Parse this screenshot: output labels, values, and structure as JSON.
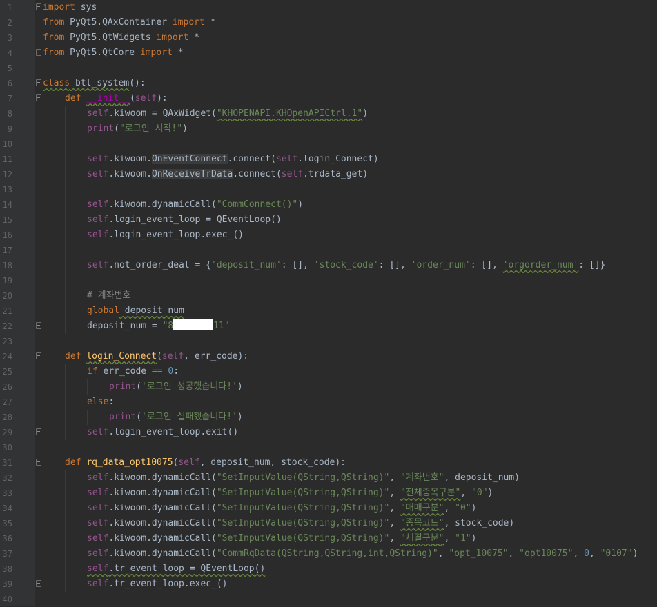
{
  "editor": {
    "colors": {
      "background": "#2b2b2b",
      "keyword": "#cc7832",
      "string": "#6a8759",
      "self": "#94558d",
      "number": "#6897bb",
      "comment": "#808080",
      "function": "#ffc66d"
    },
    "line_numbers": [
      "1",
      "2",
      "3",
      "4",
      "5",
      "6",
      "7",
      "8",
      "9",
      "10",
      "11",
      "12",
      "13",
      "14",
      "15",
      "16",
      "17",
      "18",
      "19",
      "20",
      "21",
      "22",
      "23",
      "24",
      "25",
      "26",
      "27",
      "28",
      "29",
      "30",
      "31",
      "32",
      "33",
      "34",
      "35",
      "36",
      "37",
      "38",
      "39",
      "40"
    ],
    "lines": {
      "l1": {
        "kw": "import",
        "rest": " sys"
      },
      "l2": {
        "kw1": "from",
        "mod": " PyQt5.QAxContainer ",
        "kw2": "import",
        "rest": " *"
      },
      "l3": {
        "kw1": "from",
        "mod": " PyQt5.QtWidgets ",
        "kw2": "import",
        "rest": " *"
      },
      "l4": {
        "kw1": "from",
        "mod": " PyQt5.QtCore ",
        "kw2": "import",
        "rest": " *"
      },
      "l6": {
        "kw": "class",
        "name": " btl_system",
        "rest": "():"
      },
      "l7": {
        "kw": "def ",
        "fn": "__init__",
        "p1": "(",
        "self": "self",
        "p2": "):"
      },
      "l8": {
        "self": "self",
        "a": ".kiwoom = QAxWidget(",
        "str": "\"KHOPENAPI.KHOpenAPICtrl.1\"",
        "b": ")"
      },
      "l9": {
        "fn": "print",
        "a": "(",
        "str": "\"로그인 시작!\"",
        "b": ")"
      },
      "l11": {
        "self": "self",
        "a": ".kiwoom.",
        "hl": "OnEventConnect",
        "b": ".connect(",
        "self2": "self",
        "c": ".login_Connect)"
      },
      "l12": {
        "self": "self",
        "a": ".kiwoom.",
        "hl": "OnReceiveTrData",
        "b": ".connect(",
        "self2": "self",
        "c": ".trdata_get)"
      },
      "l14": {
        "self": "self",
        "a": ".kiwoom.dynamicCall(",
        "str": "\"CommConnect()\"",
        "b": ")"
      },
      "l15": {
        "self": "self",
        "a": ".login_event_loop = QEventLoop()"
      },
      "l16": {
        "self": "self",
        "a": ".login_event_loop.exec_()"
      },
      "l18": {
        "self": "self",
        "a": ".not_order_deal = {",
        "s1": "'deposit_num'",
        "b": ": [], ",
        "s2": "'stock_code'",
        "c": ": [], ",
        "s3": "'order_num'",
        "d": ": [], ",
        "s4": "'orgorder_num'",
        "e": ": []}"
      },
      "l20": {
        "cmt": "# 계좌번호"
      },
      "l21": {
        "kw": "global",
        "rest": " deposit_num"
      },
      "l22": {
        "a": "deposit_num = ",
        "s1": "\"8",
        "s2": "11\""
      },
      "l24": {
        "kw": "def ",
        "fn": "login_Connect",
        "p1": "(",
        "self": "self",
        "p2": ", err_code):"
      },
      "l25": {
        "kw": "if",
        "a": " err_code == ",
        "num": "0",
        "b": ":"
      },
      "l26": {
        "fn": "print",
        "a": "(",
        "str": "'로그인 성공했습니다!'",
        "b": ")"
      },
      "l27": {
        "kw": "else",
        "a": ":"
      },
      "l28": {
        "fn": "print",
        "a": "(",
        "str": "'로그인 실패했습니다!'",
        "b": ")"
      },
      "l29": {
        "self": "self",
        "a": ".login_event_loop.exit()"
      },
      "l31": {
        "kw": "def ",
        "fn": "rq_data_opt10075",
        "p1": "(",
        "self": "self",
        "p2": ", deposit_num, stock_code):"
      },
      "l32": {
        "self": "self",
        "a": ".kiwoom.dynamicCall(",
        "s1": "\"SetInputValue(QString,QString)\"",
        "b": ", ",
        "s2": "\"계좌번호\"",
        "c": ", deposit_num)"
      },
      "l33": {
        "self": "self",
        "a": ".kiwoom.dynamicCall(",
        "s1": "\"SetInputValue(QString,QString)\"",
        "b": ", ",
        "s2": "\"전체종목구분\"",
        "c": ", ",
        "s3": "\"0\"",
        "d": ")"
      },
      "l34": {
        "self": "self",
        "a": ".kiwoom.dynamicCall(",
        "s1": "\"SetInputValue(QString,QString)\"",
        "b": ", ",
        "s2": "\"매매구분\"",
        "c": ", ",
        "s3": "\"0\"",
        "d": ")"
      },
      "l35": {
        "self": "self",
        "a": ".kiwoom.dynamicCall(",
        "s1": "\"SetInputValue(QString,QString)\"",
        "b": ", ",
        "s2": "\"종목코드\"",
        "c": ", stock_code)"
      },
      "l36": {
        "self": "self",
        "a": ".kiwoom.dynamicCall(",
        "s1": "\"SetInputValue(QString,QString)\"",
        "b": ", ",
        "s2": "\"체결구분\"",
        "c": ", ",
        "s3": "\"1\"",
        "d": ")"
      },
      "l37": {
        "self": "self",
        "a": ".kiwoom.dynamicCall(",
        "s1": "\"CommRqData(QString,QString,int,QString)\"",
        "b": ", ",
        "s2": "\"opt_10075\"",
        "c": ", ",
        "s3": "\"opt10075\"",
        "d": ", ",
        "num": "0",
        "e": ", ",
        "s4": "\"0107\"",
        "f": ")"
      },
      "l38": {
        "self": "self",
        "a": ".tr_event_loop = QEventLoop()"
      },
      "l39": {
        "self": "self",
        "a": ".tr_event_loop.exec_()"
      }
    }
  }
}
